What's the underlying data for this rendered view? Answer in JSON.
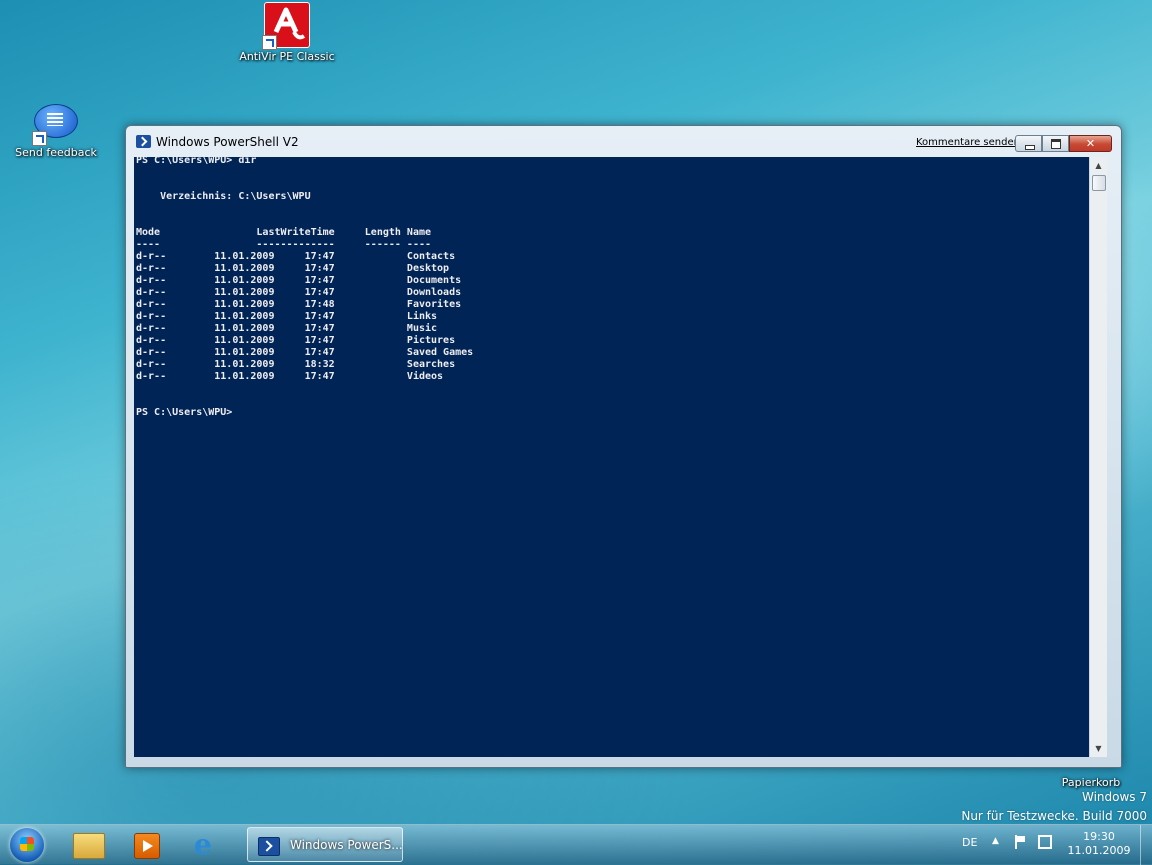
{
  "desktop": {
    "icons": [
      {
        "label": "AntiVir PE Classic"
      },
      {
        "label": "Send feedback"
      },
      {
        "label": "Papierkorb"
      }
    ]
  },
  "window": {
    "title": "Windows PowerShell V2",
    "feedback_link": "Kommentare senden",
    "console_lines": [
      "PS C:\\Users\\WPU> dir",
      "",
      "",
      "    Verzeichnis: C:\\Users\\WPU",
      "",
      "",
      "Mode                LastWriteTime     Length Name",
      "----                -------------     ------ ----",
      "d-r--        11.01.2009     17:47            Contacts",
      "d-r--        11.01.2009     17:47            Desktop",
      "d-r--        11.01.2009     17:47            Documents",
      "d-r--        11.01.2009     17:47            Downloads",
      "d-r--        11.01.2009     17:48            Favorites",
      "d-r--        11.01.2009     17:47            Links",
      "d-r--        11.01.2009     17:47            Music",
      "d-r--        11.01.2009     17:47            Pictures",
      "d-r--        11.01.2009     17:47            Saved Games",
      "d-r--        11.01.2009     18:32            Searches",
      "d-r--        11.01.2009     17:47            Videos",
      "",
      "",
      "PS C:\\Users\\WPU>"
    ]
  },
  "watermark": {
    "line1": "Windows 7",
    "line2": "Nur für Testzwecke. Build 7000"
  },
  "taskbar": {
    "active_task_label": "Windows PowerS...",
    "language": "DE",
    "time": "19:30",
    "date": "11.01.2009"
  }
}
